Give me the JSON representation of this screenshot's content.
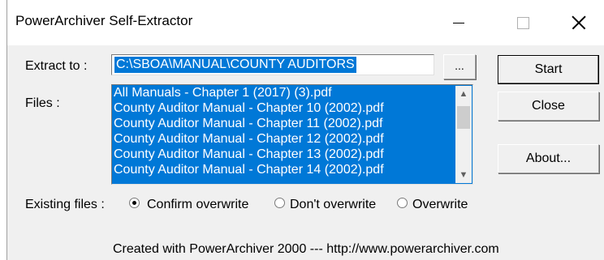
{
  "window": {
    "title": "PowerArchiver Self-Extractor"
  },
  "extract": {
    "label": "Extract to :",
    "path": "C:\\SBOA\\MANUAL\\COUNTY AUDITORS",
    "browse_label": "..."
  },
  "files": {
    "label": "Files :",
    "items": [
      "All Manuals - Chapter 1 (2017) (3).pdf",
      "County Auditor Manual - Chapter 10 (2002).pdf",
      "County Auditor Manual - Chapter 11 (2002).pdf",
      "County Auditor Manual - Chapter 12 (2002).pdf",
      "County Auditor Manual - Chapter 13 (2002).pdf",
      "County Auditor Manual - Chapter 14 (2002).pdf"
    ],
    "scroll_up_icon": "chevron-up-icon",
    "scroll_down_icon": "chevron-down-icon"
  },
  "buttons": {
    "start": "Start",
    "close": "Close",
    "about": "About..."
  },
  "existing_files": {
    "label": "Existing files :",
    "options": [
      {
        "label": "Confirm overwrite",
        "checked": true
      },
      {
        "label": "Don't overwrite",
        "checked": false
      },
      {
        "label": "Overwrite",
        "checked": false
      }
    ]
  },
  "footer": "Created with PowerArchiver 2000 --- http://www.powerarchiver.com",
  "colors": {
    "selection": "#0078d7",
    "dialog_bg": "#f0f0f0"
  }
}
